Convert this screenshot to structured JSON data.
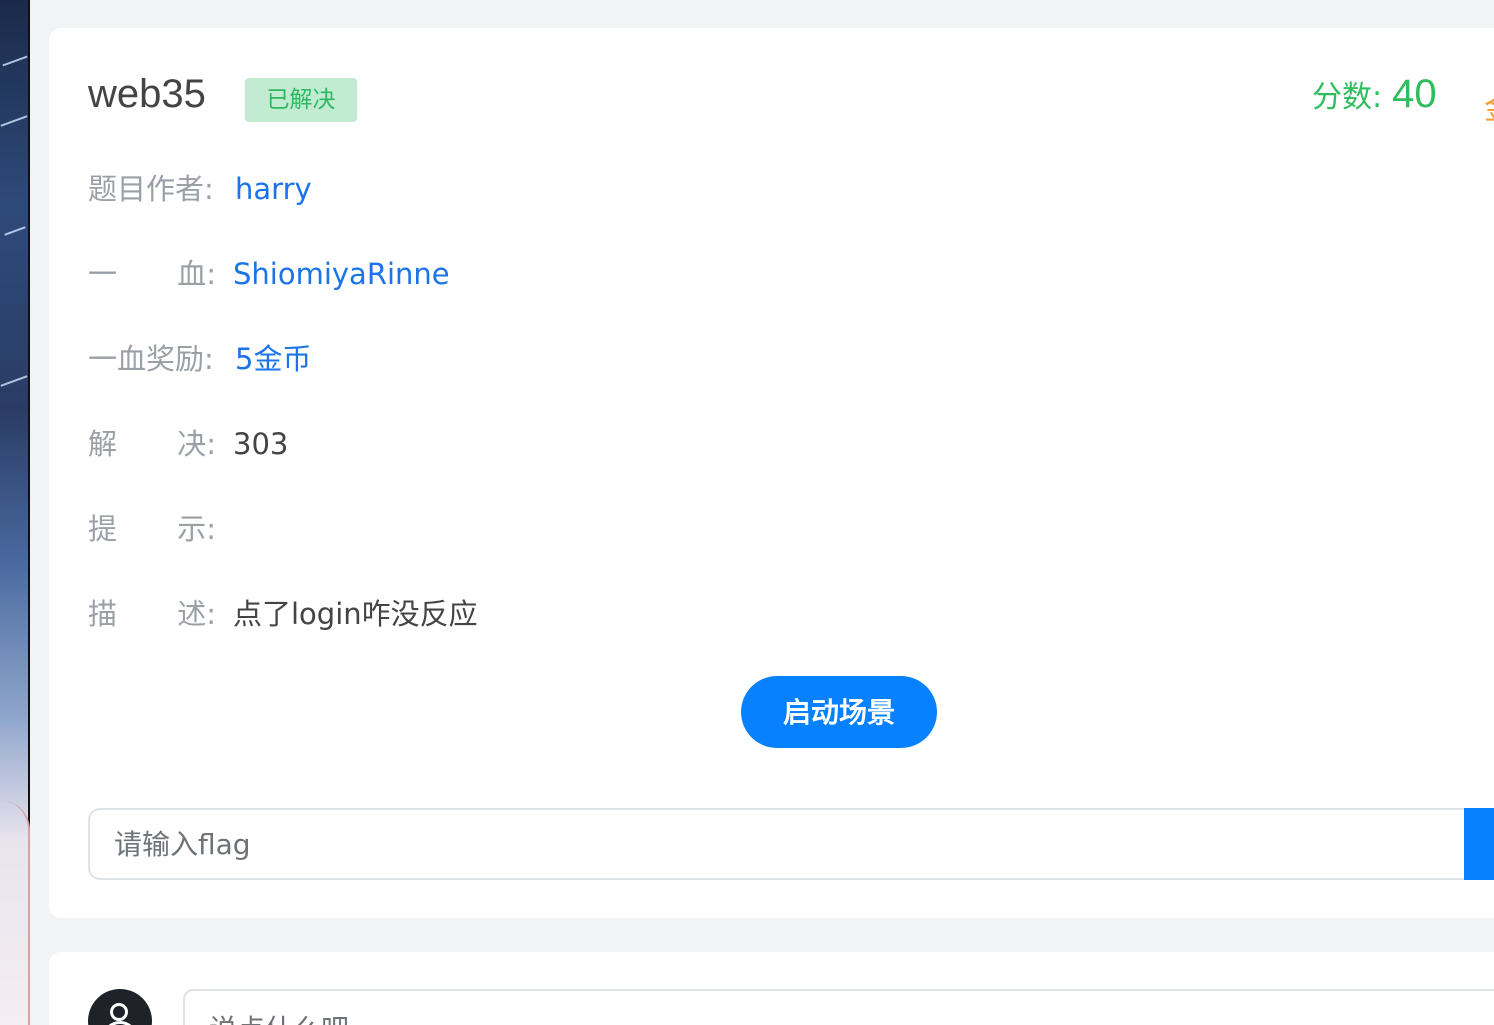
{
  "challenge": {
    "name": "web35",
    "status_badge": "已解决",
    "score_label": "分数:",
    "score_value": "40"
  },
  "details": {
    "author": {
      "label": "题目作者:",
      "value": "harry"
    },
    "first_blood": {
      "label_left": "一",
      "label_right": "血:",
      "value": "ShiomiyaRinne"
    },
    "first_blood_reward": {
      "label": "一血奖励:",
      "value": "5金币"
    },
    "solves": {
      "label_left": "解",
      "label_right": "决:",
      "value": "303"
    },
    "hint": {
      "label_left": "提",
      "label_right": "示:",
      "value": ""
    },
    "description": {
      "label_left": "描",
      "label_right": "述:",
      "value": "点了login咋没反应"
    }
  },
  "actions": {
    "start_scene_label": "启动场景"
  },
  "flag_form": {
    "placeholder": "请输入flag"
  },
  "comment_form": {
    "placeholder": "说点什么吧"
  },
  "colors": {
    "accent_blue": "#0881fe",
    "link_blue": "#1b74e8",
    "success_green": "#30bd5e",
    "badge_bg": "#c2ecd1"
  }
}
